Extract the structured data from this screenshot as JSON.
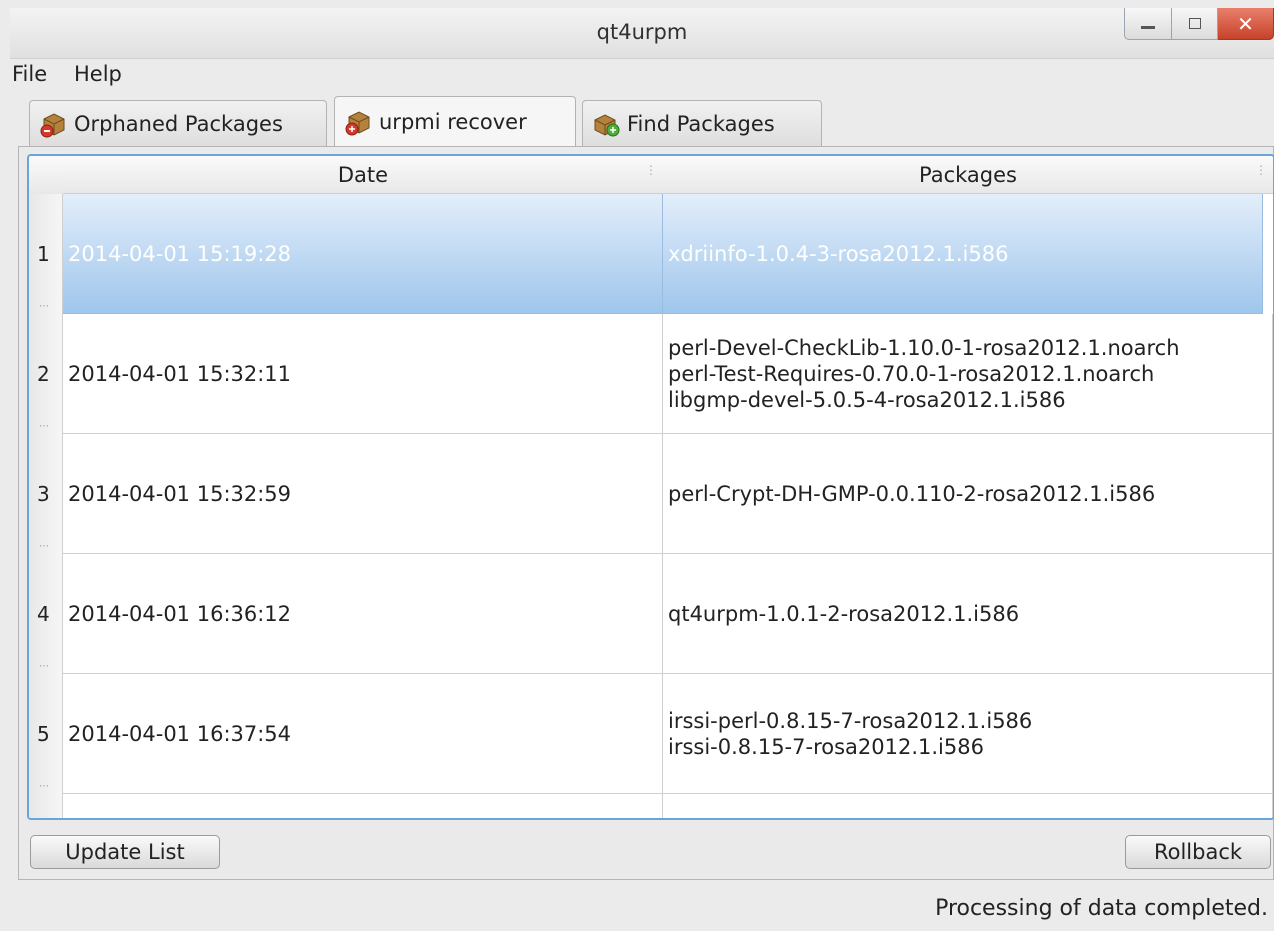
{
  "window": {
    "title": "qt4urpm",
    "controls": {
      "minimize": "minimize-icon",
      "maximize": "maximize-icon",
      "close": "close-icon"
    }
  },
  "menu": [
    "File",
    "Help"
  ],
  "tabs": [
    {
      "label": "Orphaned Packages",
      "icon": "package-remove-icon",
      "active": false
    },
    {
      "label": "urpmi recover",
      "icon": "package-icon",
      "active": true
    },
    {
      "label": "Find Packages",
      "icon": "package-search-icon",
      "active": false
    }
  ],
  "table": {
    "columns": [
      "Date",
      "Packages"
    ],
    "rows": [
      {
        "index": "1",
        "date": "2014-04-01 15:19:28",
        "packages": [
          "xdriinfo-1.0.4-3-rosa2012.1.i586"
        ],
        "selected": true
      },
      {
        "index": "2",
        "date": "2014-04-01 15:32:11",
        "packages": [
          "perl-Devel-CheckLib-1.10.0-1-rosa2012.1.noarch",
          "perl-Test-Requires-0.70.0-1-rosa2012.1.noarch",
          "libgmp-devel-5.0.5-4-rosa2012.1.i586"
        ],
        "selected": false
      },
      {
        "index": "3",
        "date": "2014-04-01 15:32:59",
        "packages": [
          "perl-Crypt-DH-GMP-0.0.110-2-rosa2012.1.i586"
        ],
        "selected": false
      },
      {
        "index": "4",
        "date": "2014-04-01 16:36:12",
        "packages": [
          "qt4urpm-1.0.1-2-rosa2012.1.i586"
        ],
        "selected": false
      },
      {
        "index": "5",
        "date": "2014-04-01 16:37:54",
        "packages": [
          "irssi-perl-0.8.15-7-rosa2012.1.i586",
          "irssi-0.8.15-7-rosa2012.1.i586"
        ],
        "selected": false
      }
    ]
  },
  "buttons": {
    "update": "Update List",
    "rollback": "Rollback"
  },
  "status": "Processing of data completed.",
  "colors": {
    "selection_top": "#e3eefa",
    "selection_bottom": "#9fc6ec",
    "focus_border": "#6ba3da",
    "close_button": "#c7422a"
  }
}
